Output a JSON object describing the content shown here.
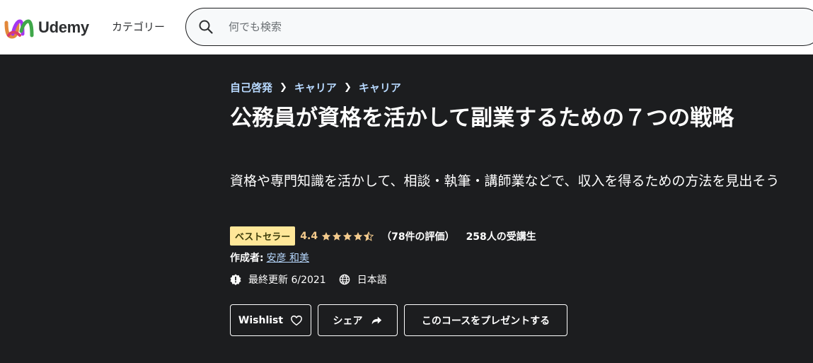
{
  "header": {
    "logo_text": "Udemy",
    "categories_label": "カテゴリー",
    "search": {
      "placeholder": "何でも検索",
      "icon": "search-icon"
    }
  },
  "breadcrumb": [
    {
      "label": "自己啓発"
    },
    {
      "label": "キャリア"
    },
    {
      "label": "キャリア"
    }
  ],
  "course": {
    "title": "公務員が資格を活かして副業するための７つの戦略",
    "subtitle": "資格や専門知識を活かして、相談・執筆・講師業などで、収入を得るための方法を見出そう",
    "badge": "ベストセラー",
    "rating": "4.4",
    "rating_value": 4.4,
    "rating_max": 5,
    "rating_count": "（78件の評価）",
    "students": "258人の受講生",
    "instructor_label": "作成者:",
    "instructor_name": "安彦 和美",
    "last_updated": "最終更新 6/2021",
    "language": "日本語"
  },
  "actions": {
    "wishlist": "Wishlist",
    "share": "シェア",
    "gift": "このコースをプレゼントする"
  },
  "colors": {
    "hero_background": "#1c1d1f",
    "header_background": "#ffffff",
    "badge_background": "#ffe799",
    "rating_color": "#f3ca8c",
    "link_color": "#b8d9ff"
  }
}
